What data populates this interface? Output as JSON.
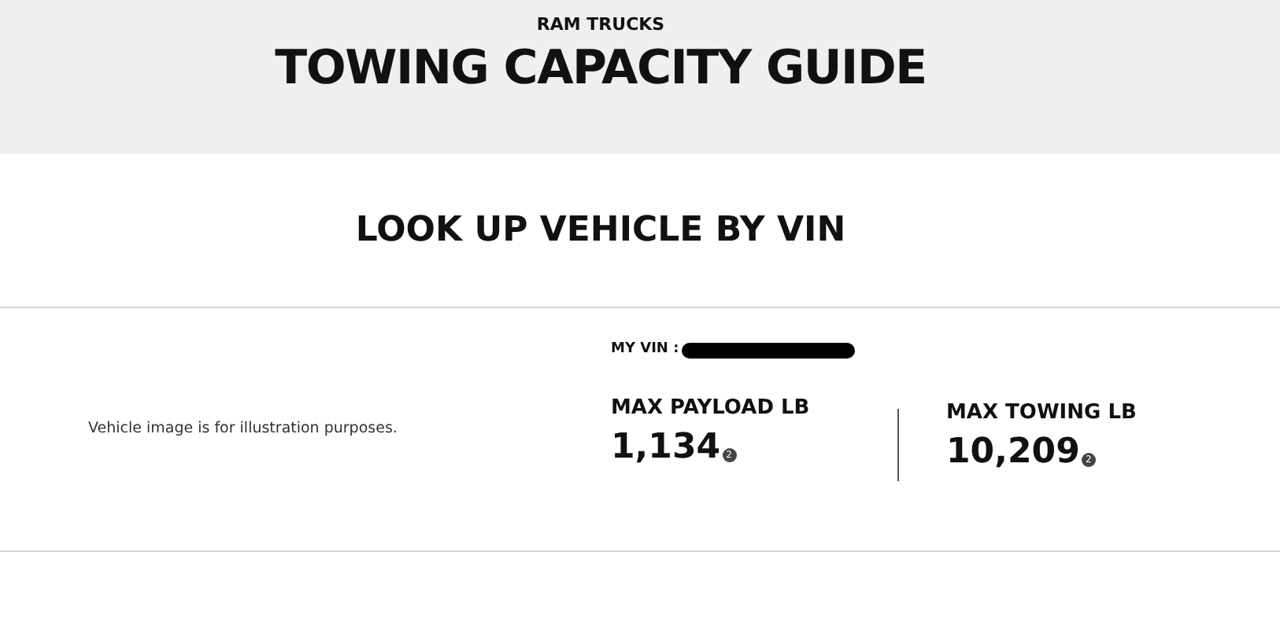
{
  "header": {
    "brand": "RAM TRUCKS",
    "title": "TOWING CAPACITY GUIDE"
  },
  "lookup": {
    "heading": "LOOK UP VEHICLE BY VIN"
  },
  "vehicle": {
    "image_note": "Vehicle image is for illustration purposes.",
    "vin_label": "MY VIN :",
    "stats": [
      {
        "label": "MAX PAYLOAD LB",
        "value": "1,134",
        "footnote": "2"
      },
      {
        "label": "MAX TOWING LB",
        "value": "10,209",
        "footnote": "2"
      }
    ]
  }
}
